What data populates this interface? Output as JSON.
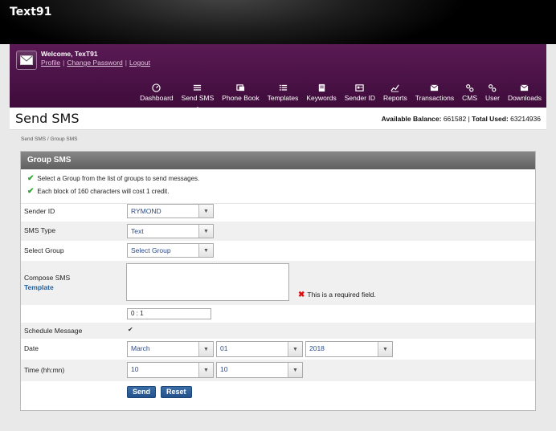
{
  "app": {
    "brand": "Text91"
  },
  "user": {
    "welcome": "Welcome, TexT91",
    "links": [
      "Profile",
      "Change Password",
      "Logout"
    ]
  },
  "nav": [
    {
      "label": "Dashboard",
      "icon": "dashboard-icon"
    },
    {
      "label": "Send SMS",
      "icon": "send-sms-icon",
      "active": true
    },
    {
      "label": "Phone Book",
      "icon": "phone-book-icon"
    },
    {
      "label": "Templates",
      "icon": "templates-icon"
    },
    {
      "label": "Keywords",
      "icon": "keywords-icon"
    },
    {
      "label": "Sender ID",
      "icon": "sender-id-icon"
    },
    {
      "label": "Reports",
      "icon": "reports-icon"
    },
    {
      "label": "Transactions",
      "icon": "transactions-icon"
    },
    {
      "label": "CMS",
      "icon": "cms-icon"
    },
    {
      "label": "User",
      "icon": "user-icon"
    },
    {
      "label": "Downloads",
      "icon": "downloads-icon"
    }
  ],
  "page": {
    "title": "Send SMS",
    "balance_label": "Available Balance:",
    "balance_value": "661582",
    "used_label": "Total Used:",
    "used_value": "63214936",
    "breadcrumb": "Send SMS  /  Group SMS"
  },
  "panel": {
    "title": "Group SMS",
    "notes": [
      "Select a Group from the list of groups to send messages.",
      "Each block of 160 characters will cost 1 credit."
    ]
  },
  "form": {
    "sender_id_label": "Sender ID",
    "sender_id_value": "RYMOND",
    "sms_type_label": "SMS Type",
    "sms_type_value": "Text",
    "select_group_label": "Select Group",
    "select_group_value": "Select Group",
    "compose_label": "Compose SMS",
    "template_link": "Template",
    "required_msg": "This is a required field.",
    "counter": "0 : 1",
    "schedule_label": "Schedule Message",
    "date_label": "Date",
    "month": "March",
    "day": "01",
    "year": "2018",
    "time_label": "Time (hh:mn)",
    "hour": "10",
    "minute": "10",
    "send": "Send",
    "reset": "Reset"
  },
  "colors": {
    "header_purple": "#4e1449",
    "button_blue": "#2c5f99",
    "check_green": "#2fa32f",
    "error_red": "#d11111"
  }
}
